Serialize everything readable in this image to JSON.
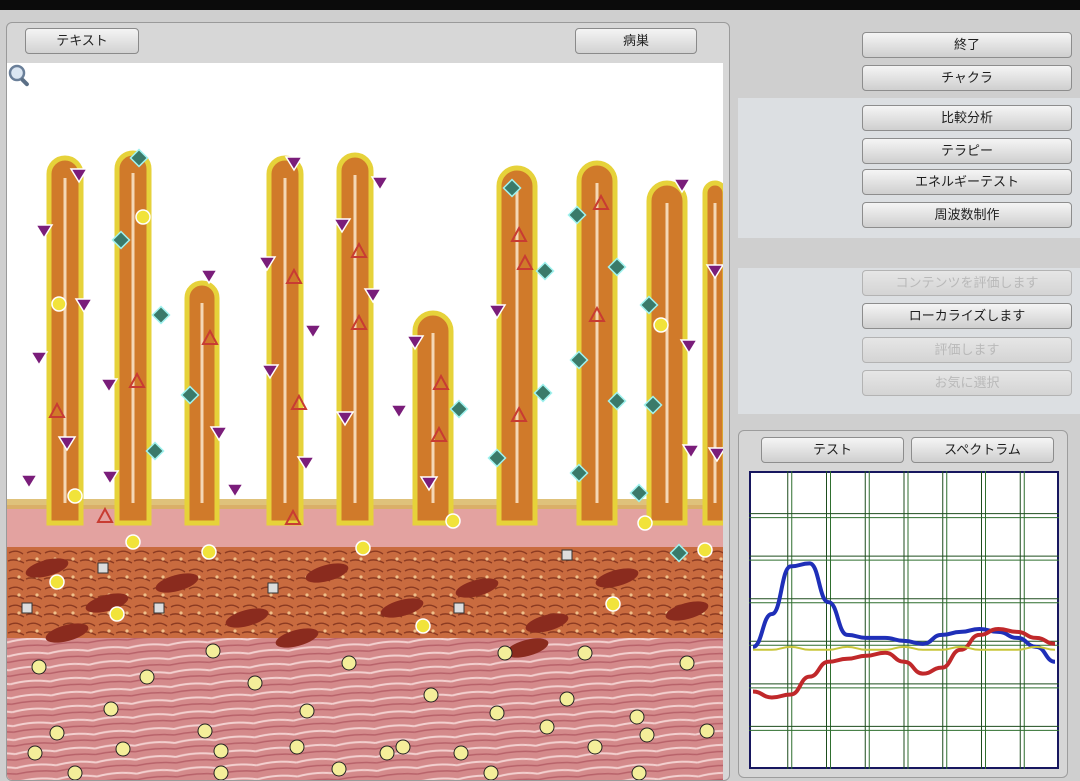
{
  "viewer": {
    "text_button": "テキスト",
    "pathology_button": "病巣",
    "zoom_icon": "magnifier-icon"
  },
  "menu": {
    "exit": "終了",
    "chakra": "チャクラ",
    "compare": "比較分析",
    "therapy": "テラピー",
    "energy_test": "エネルギーテスト",
    "frequency": "周波数制作",
    "disabled_1": "コンテンツを評価します",
    "localize": "ローカライズします",
    "disabled_2": "評価します",
    "disabled_3": "お気に選択"
  },
  "spectrum_panel": {
    "test_button": "テスト",
    "spectrum_button": "スペクトラム"
  },
  "chart_data": {
    "type": "line",
    "x": [
      0,
      1,
      2,
      3,
      4,
      5,
      6,
      7,
      8,
      9,
      10,
      11,
      12,
      13,
      14,
      15,
      16
    ],
    "ylim": [
      0,
      10
    ],
    "grid": true,
    "series": [
      {
        "color": "#1f2fb8",
        "values": [
          4.1,
          5.2,
          6.8,
          6.9,
          5.6,
          4.5,
          4.4,
          4.4,
          4.3,
          4.2,
          4.5,
          4.6,
          4.7,
          4.6,
          4.4,
          4.1,
          3.6
        ]
      },
      {
        "color": "#c0282a",
        "values": [
          2.6,
          2.4,
          2.5,
          3.1,
          3.6,
          3.7,
          3.8,
          3.9,
          3.6,
          3.2,
          3.4,
          4.0,
          4.5,
          4.7,
          4.6,
          4.4,
          4.2
        ]
      },
      {
        "color": "#c9c53a",
        "values": [
          4.0,
          4.0,
          4.1,
          4.0,
          4.0,
          4.1,
          4.0,
          4.0,
          4.1,
          4.0,
          4.0,
          4.1,
          4.0,
          4.0,
          4.0,
          4.1,
          4.0
        ]
      }
    ]
  },
  "colors": {
    "villi": "#d07a2a",
    "villi_edge": "#e6d23a",
    "mucosa": "#d88b86",
    "muscle": "#d98c8f",
    "marker_triangle_down": "#7a1d7a",
    "marker_triangle_up": "#c83c32",
    "marker_diamond": "#3a7a6a",
    "marker_yellow": "#f1e33a"
  }
}
